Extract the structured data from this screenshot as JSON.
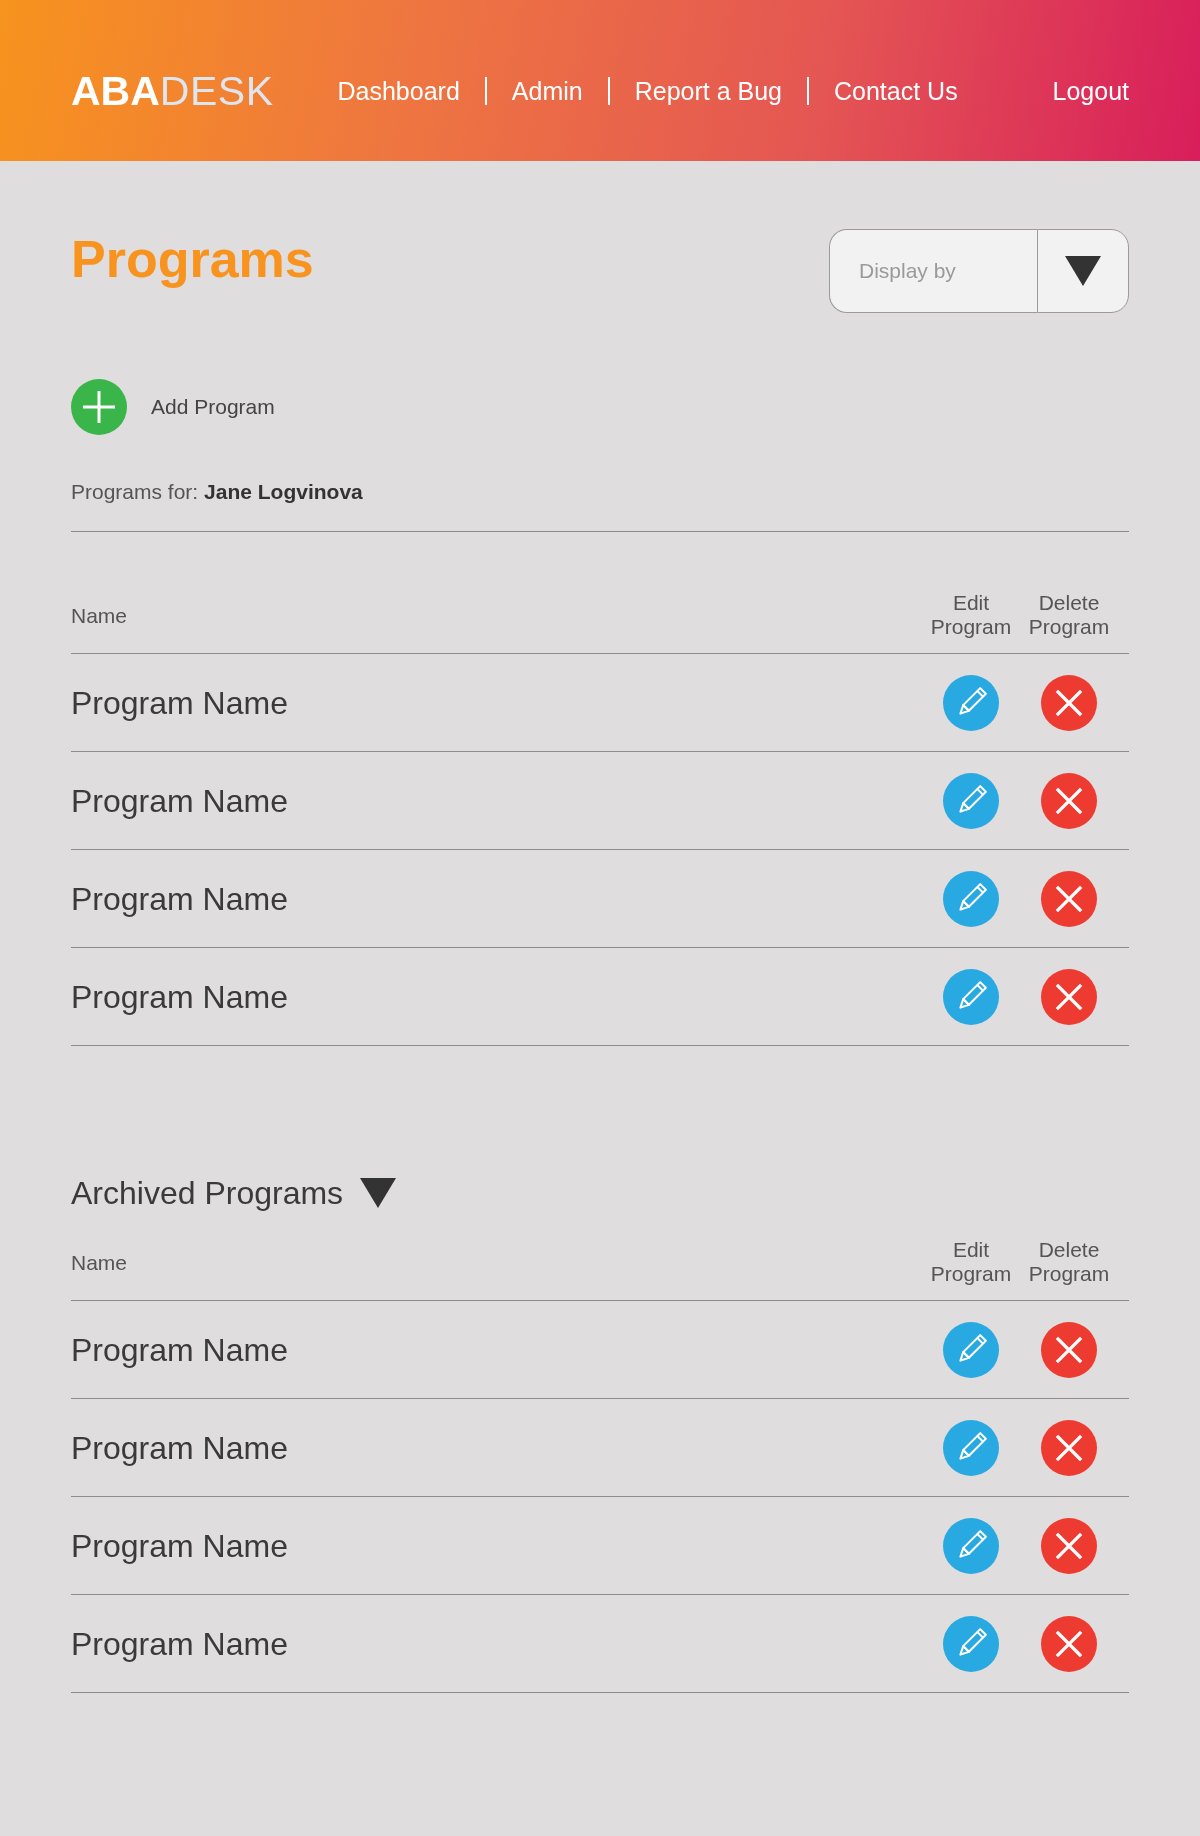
{
  "header": {
    "logo": {
      "strong": "ABA",
      "light": "DESK"
    },
    "nav": [
      {
        "label": "Dashboard"
      },
      {
        "label": "Admin"
      },
      {
        "label": "Report a Bug"
      },
      {
        "label": "Contact Us"
      }
    ],
    "logout": "Logout"
  },
  "page_title": "Programs",
  "display_by": {
    "placeholder": "Display by"
  },
  "add_program": {
    "label": "Add Program"
  },
  "programs_for": "Programs for: **Jane Logvinova**",
  "programs_table": {
    "columns": [
      "Name",
      "Edit Program",
      "Delete Program"
    ],
    "rows": [
      {
        "name": "Program Name"
      },
      {
        "name": "Program Name"
      },
      {
        "name": "Program Name"
      },
      {
        "name": "Program Name"
      }
    ]
  },
  "archived": {
    "title": "Archived Programs",
    "expanded": true,
    "table": {
      "columns": [
        "Name",
        "Edit Program",
        "Delete Program"
      ],
      "rows": [
        {
          "name": "Program Name"
        },
        {
          "name": "Program Name"
        },
        {
          "name": "Program Name"
        },
        {
          "name": "Program Name"
        }
      ]
    }
  }
}
